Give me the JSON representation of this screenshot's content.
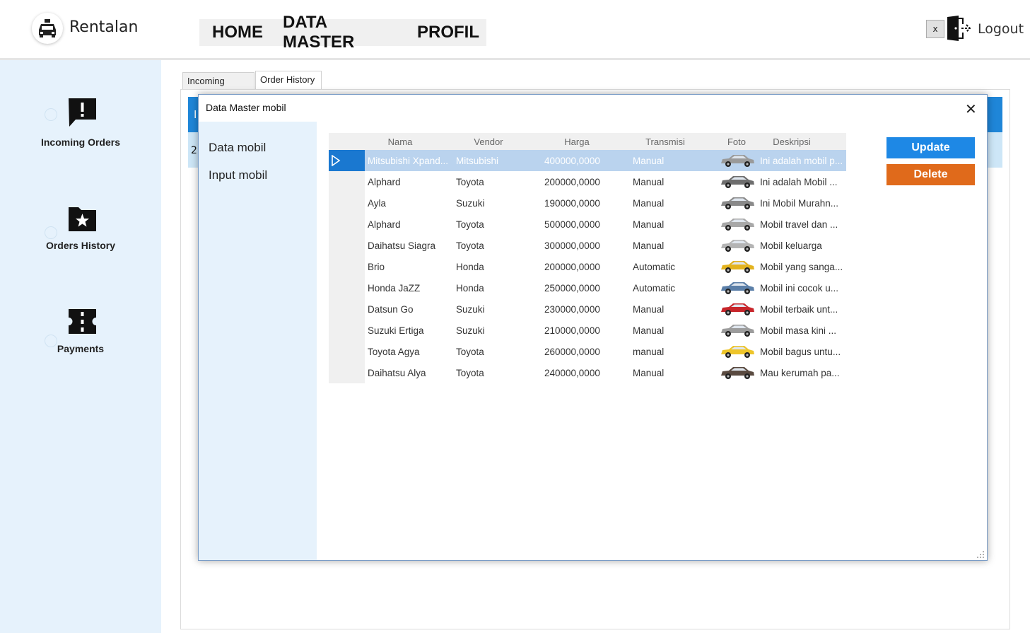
{
  "app": {
    "brand": "Rentalan"
  },
  "nav": {
    "items": [
      "HOME",
      "DATA MASTER",
      "PROFIL"
    ]
  },
  "header": {
    "close_label": "x",
    "logout_label": "Logout"
  },
  "sidebar": {
    "items": [
      {
        "label": "Incoming Orders",
        "icon": "alert-message-icon"
      },
      {
        "label": "Orders History",
        "icon": "star-folder-icon"
      },
      {
        "label": "Payments",
        "icon": "ticket-icon"
      }
    ]
  },
  "main": {
    "tabs": [
      "Incoming Order",
      "Order History"
    ],
    "active_tab": "Order History",
    "peek_header": "I",
    "peek_row": "2:"
  },
  "dialog": {
    "title": "Data Master mobil",
    "close_glyph": "✕",
    "menu": [
      "Data mobil",
      "Input mobil"
    ],
    "columns": [
      "Nama",
      "Vendor",
      "Harga",
      "Transmisi",
      "Foto",
      "Deskripsi"
    ],
    "rows": [
      {
        "nama": "Mitsubishi Xpand...",
        "vendor": "Mitsubishi",
        "harga": "400000,0000",
        "transmisi": "Manual",
        "foto_color": "#9a9a9a",
        "deskripsi": "Ini adalah mobil p...",
        "selected": true
      },
      {
        "nama": "Alphard",
        "vendor": "Toyota",
        "harga": "200000,0000",
        "transmisi": "Manual",
        "foto_color": "#6e6e6e",
        "deskripsi": "Ini adalah Mobil ..."
      },
      {
        "nama": "Ayla",
        "vendor": "Suzuki",
        "harga": "190000,0000",
        "transmisi": "Manual",
        "foto_color": "#8a8a8a",
        "deskripsi": "Ini Mobil Murahn..."
      },
      {
        "nama": "Alphard",
        "vendor": "Toyota",
        "harga": "500000,0000",
        "transmisi": "Manual",
        "foto_color": "#a8a8a8",
        "deskripsi": "Mobil travel dan ..."
      },
      {
        "nama": "Daihatsu Siagra",
        "vendor": "Toyota",
        "harga": "300000,0000",
        "transmisi": "Manual",
        "foto_color": "#b4b4b4",
        "deskripsi": "Mobil keluarga"
      },
      {
        "nama": "Brio",
        "vendor": "Honda",
        "harga": "200000,0000",
        "transmisi": "Automatic",
        "foto_color": "#e3b31f",
        "deskripsi": "Mobil yang sanga..."
      },
      {
        "nama": "Honda JaZZ",
        "vendor": "Honda",
        "harga": "250000,0000",
        "transmisi": "Automatic",
        "foto_color": "#5b7fa8",
        "deskripsi": "Mobil ini cocok u..."
      },
      {
        "nama": "Datsun Go",
        "vendor": "Suzuki",
        "harga": "230000,0000",
        "transmisi": "Manual",
        "foto_color": "#c8262b",
        "deskripsi": "Mobil terbaik unt..."
      },
      {
        "nama": "Suzuki Ertiga",
        "vendor": "Suzuki",
        "harga": "210000,0000",
        "transmisi": "Manual",
        "foto_color": "#9c9c9c",
        "deskripsi": "Mobil masa kini ..."
      },
      {
        "nama": "Toyota Agya",
        "vendor": "Toyota",
        "harga": "260000,0000",
        "transmisi": "manual",
        "foto_color": "#eec52a",
        "deskripsi": "Mobil bagus untu..."
      },
      {
        "nama": "Daihatsu Alya",
        "vendor": "Toyota",
        "harga": "240000,0000",
        "transmisi": "Manual",
        "foto_color": "#5a4a40",
        "deskripsi": "Mau kerumah pa..."
      }
    ],
    "update_label": "Update",
    "delete_label": "Delete",
    "colors": {
      "update": "#1e88e5",
      "delete": "#e06a1b",
      "selected_row": "#bad3ee",
      "row_header_selected": "#1a78d0"
    }
  }
}
